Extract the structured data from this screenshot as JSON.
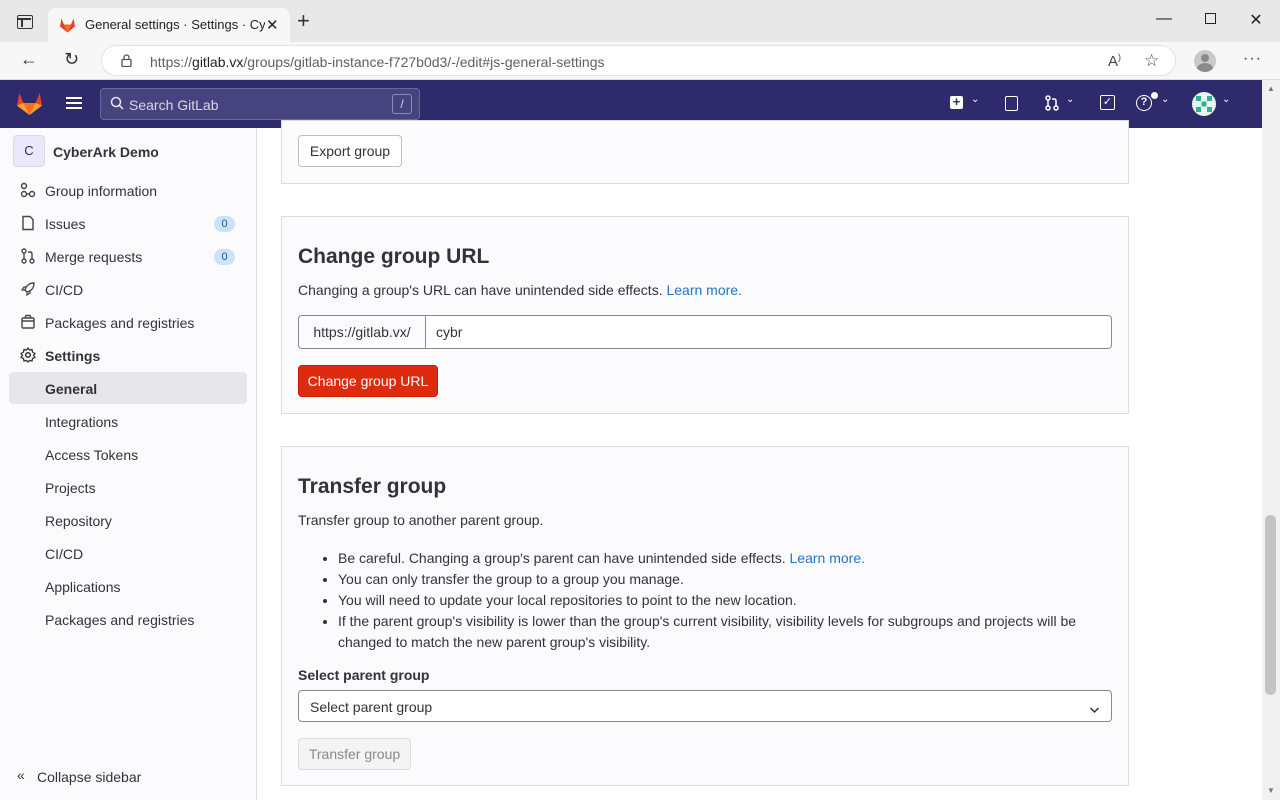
{
  "browser": {
    "tab_title": "General settings · Settings · CyberArk Demo",
    "url_prefix": "https://",
    "url_host": "gitlab.vx",
    "url_path": "/groups/gitlab-instance-f727b0d3/-/edit#js-general-settings"
  },
  "header": {
    "search_placeholder": "Search GitLab",
    "search_shortcut": "/"
  },
  "sidebar": {
    "group_initial": "C",
    "group_name": "CyberArk Demo",
    "items": [
      {
        "label": "Group information",
        "icon": "group-info-icon"
      },
      {
        "label": "Issues",
        "icon": "issues-icon",
        "badge": "0"
      },
      {
        "label": "Merge requests",
        "icon": "merge-request-icon",
        "badge": "0"
      },
      {
        "label": "CI/CD",
        "icon": "rocket-icon"
      },
      {
        "label": "Packages and registries",
        "icon": "package-icon"
      },
      {
        "label": "Settings",
        "icon": "settings-icon"
      }
    ],
    "settings_subitems": [
      "General",
      "Integrations",
      "Access Tokens",
      "Projects",
      "Repository",
      "CI/CD",
      "Applications",
      "Packages and registries"
    ],
    "collapse_label": "Collapse sidebar"
  },
  "export": {
    "button_label": "Export group"
  },
  "change_url": {
    "title": "Change group URL",
    "description": "Changing a group's URL can have unintended side effects.",
    "learn_more": "Learn more.",
    "prefix": "https://gitlab.vx/",
    "value": "cybr",
    "button_label": "Change group URL"
  },
  "transfer": {
    "title": "Transfer group",
    "description": "Transfer group to another parent group.",
    "bullets": [
      "Be careful. Changing a group's parent can have unintended side effects.",
      "You can only transfer the group to a group you manage.",
      "You will need to update your local repositories to point to the new location.",
      "If the parent group's visibility is lower than the group's current visibility, visibility levels for subgroups and projects will be changed to match the new parent group's visibility."
    ],
    "learn_more": "Learn more.",
    "select_label": "Select parent group",
    "select_value": "Select parent group",
    "button_label": "Transfer group"
  },
  "colors": {
    "header_bg": "#2f2a6b",
    "danger": "#dd2b0e",
    "link": "#1f75cb"
  }
}
